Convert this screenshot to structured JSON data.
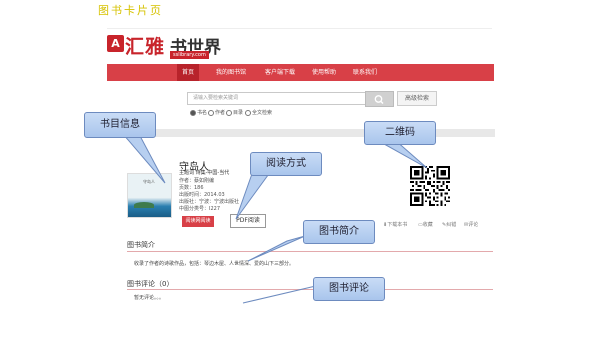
{
  "caption": "图书卡片页",
  "logo": {
    "badge": "A",
    "main": "汇雅",
    "sub": "书世界",
    "url": "sslibrary.com"
  },
  "nav": [
    "首页",
    "我的图书馆",
    "客户端下载",
    "使用帮助",
    "联系我们"
  ],
  "search": {
    "placeholder": "请输入要检索关键词",
    "advanced_label": "高级检索",
    "options": [
      "书名",
      "作者",
      "目录",
      "全文检索"
    ]
  },
  "book": {
    "title": "守岛人",
    "subject": "主题词 诗集-中国-当代",
    "meta": [
      "作者：蔡如刚编",
      "页数：186",
      "出版时间：2014.03",
      "出版社：宁波：宁波出版社",
      "中图分类号：I227"
    ],
    "cover_title": "守岛人",
    "read_online_label": "阅读网阅读",
    "pdf_label": "PDF阅读"
  },
  "actions": [
    "下载本书",
    "收藏",
    "纠错",
    "评论"
  ],
  "sections": {
    "intro_title": "图书简介",
    "intro_text": "收录了作者的诗歌作品，包括：琴边木屋、人世情深、爱的山下三部分。",
    "comments_title": "图书评论（0）",
    "comments_text": "暂无评论。。。"
  },
  "callouts": [
    "书目信息",
    "阅读方式",
    "二维码",
    "图书简介",
    "图书评论"
  ],
  "colors": {
    "brand_red": "#d84047",
    "callout_fill": "#b7cff0"
  }
}
